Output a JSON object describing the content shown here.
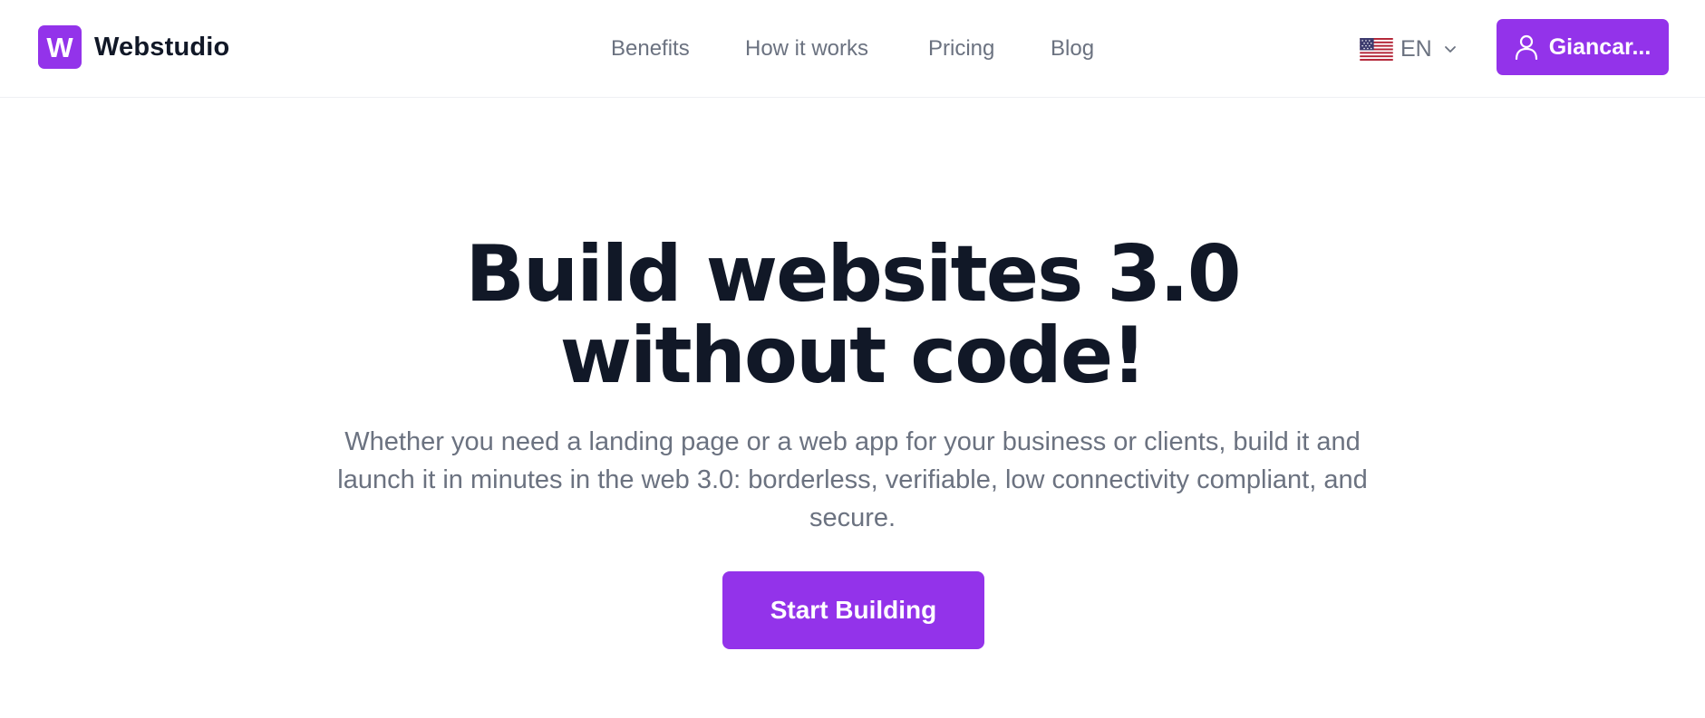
{
  "header": {
    "brand": {
      "logo_letter": "W",
      "name": "Webstudio",
      "logo_color": "#9333ea"
    },
    "nav": [
      {
        "label": "Benefits"
      },
      {
        "label": "How it works"
      },
      {
        "label": "Pricing"
      },
      {
        "label": "Blog"
      }
    ],
    "language": {
      "flag_icon": "us-flag-icon",
      "code": "EN",
      "chevron_icon": "chevron-down-icon"
    },
    "user_button": {
      "icon": "user-icon",
      "label": "Giancar..."
    }
  },
  "hero": {
    "title_line1": "Build websites 3.0",
    "title_line2": "without code!",
    "subtitle": "Whether you need a landing page or a web app for your business or clients, build it and launch it in minutes in the web 3.0: borderless, verifiable, low connectivity compliant, and secure.",
    "cta_label": "Start Building"
  },
  "colors": {
    "accent": "#9333ea",
    "heading": "#111827",
    "muted_text": "#6b7280",
    "background": "#ffffff"
  }
}
